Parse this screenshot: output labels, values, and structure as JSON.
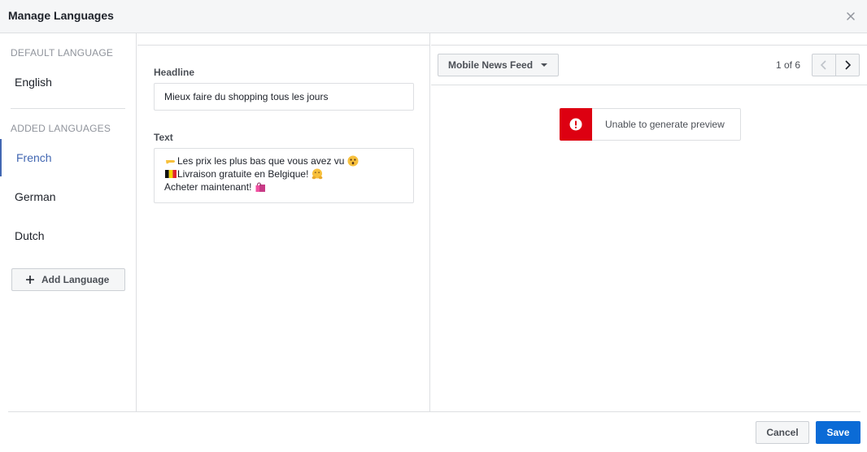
{
  "dialog": {
    "title": "Manage Languages",
    "close_icon": "close-icon"
  },
  "sidebar": {
    "default_label": "DEFAULT LANGUAGE",
    "default_language": "English",
    "added_label": "ADDED LANGUAGES",
    "added_languages": [
      {
        "label": "French",
        "active": true
      },
      {
        "label": "German",
        "active": false
      },
      {
        "label": "Dutch",
        "active": false
      }
    ],
    "add_button_label": "Add Language",
    "accent_color": "#4267b2"
  },
  "editor": {
    "headline_label": "Headline",
    "headline_value": "Mieux faire du shopping tous les jours",
    "text_label": "Text",
    "text_lines": [
      {
        "before_icon": "pointing-hand-emoji",
        "text": "Les prix les plus bas que vous avez vu",
        "after_icon": "astonished-face-emoji"
      },
      {
        "before_icon": "belgium-flag-emoji",
        "text": "Livraison gratuite en Belgique!",
        "after_icon": "hugging-face-emoji"
      },
      {
        "before_icon": "",
        "text": "Acheter maintenant!",
        "after_icon": "shopping-bags-emoji"
      }
    ]
  },
  "preview": {
    "placement": "Mobile News Feed",
    "pager_text": "1 of 6",
    "error_message": "Unable to generate preview",
    "error_color": "#dd0011"
  },
  "footer": {
    "cancel_label": "Cancel",
    "save_label": "Save"
  }
}
